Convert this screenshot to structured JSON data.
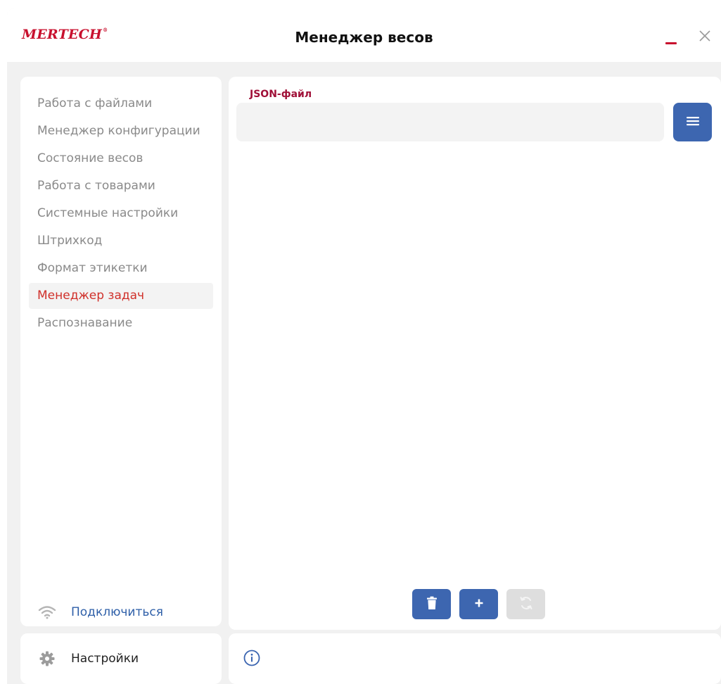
{
  "app": {
    "logo": "MERTECH",
    "logo_mark": "®",
    "title": "Менеджер весов"
  },
  "colors": {
    "brand_red": "#c8102e",
    "active_red": "#d0302a",
    "primary_blue": "#3d66b0",
    "disabled_gray": "#dedede",
    "label_maroon": "#a01038",
    "connect_blue": "#2e5fa8"
  },
  "window_controls": {
    "minimize_icon": "minimize-icon",
    "close_icon": "close-icon"
  },
  "sidebar": {
    "items": [
      {
        "label": "Работа с файлами",
        "active": false
      },
      {
        "label": "Менеджер конфигурации",
        "active": false
      },
      {
        "label": "Состояние весов",
        "active": false
      },
      {
        "label": "Работа с товарами",
        "active": false
      },
      {
        "label": "Системные настройки",
        "active": false
      },
      {
        "label": "Штрихкод",
        "active": false
      },
      {
        "label": "Формат этикетки",
        "active": false
      },
      {
        "label": "Менеджер задач",
        "active": true
      },
      {
        "label": "Распознавание",
        "active": false
      }
    ],
    "connect": {
      "label": "Подключиться",
      "icon": "wifi-icon"
    },
    "settings": {
      "label": "Настройки",
      "icon": "gear-icon"
    }
  },
  "main": {
    "json_field": {
      "label": "JSON-файл",
      "value": "",
      "placeholder": ""
    },
    "menu_button_icon": "hamburger-menu-icon",
    "actions": {
      "delete_icon": "trash-icon",
      "add_icon": "plus-icon",
      "refresh_icon": "refresh-icon",
      "refresh_enabled": false
    }
  },
  "status_bar": {
    "icon": "info-icon",
    "text": ""
  }
}
